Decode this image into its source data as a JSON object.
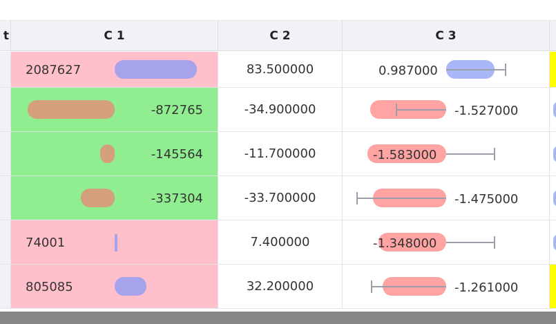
{
  "headers": [
    "t",
    "C 1",
    "C 2",
    "C 3"
  ],
  "rows": [
    {
      "c1": "2087627",
      "c1_bg": "#ffc0cb",
      "c2": "83.500000",
      "c3": "0.987000"
    },
    {
      "c1": "-872765",
      "c1_bg": "#90ee90",
      "c2": "-34.900000",
      "c3": "-1.527000"
    },
    {
      "c1": "-145564",
      "c1_bg": "#90ee90",
      "c2": "-11.700000",
      "c3": "-1.583000"
    },
    {
      "c1": "-337304",
      "c1_bg": "#90ee90",
      "c2": "-33.700000",
      "c3": "-1.475000"
    },
    {
      "c1": "74001",
      "c1_bg": "#ffc0cb",
      "c2": "7.400000",
      "c3": "-1.348000"
    },
    {
      "c1": "805085",
      "c1_bg": "#ffc0cb",
      "c2": "32.200000",
      "c3": "-1.261000"
    }
  ],
  "colors": {
    "positive_bar": "#a6a3ea",
    "negative_bar": "#d4a07b",
    "c3_positive_bar": "#a9b6f8",
    "c3_negative_bar": "#ffa3a3",
    "error_bar": "#9a9ea6",
    "highlight": "#ffff00"
  }
}
